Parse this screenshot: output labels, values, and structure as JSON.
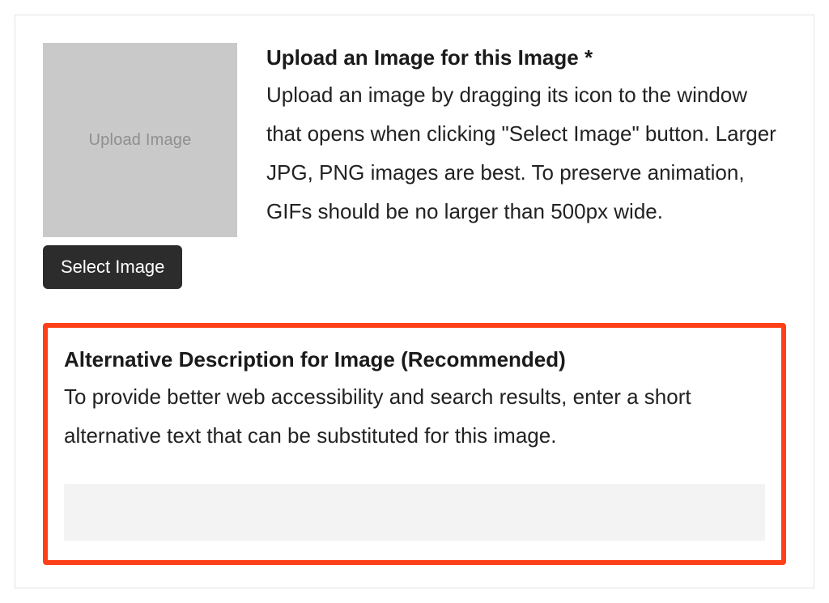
{
  "upload": {
    "placeholder_text": "Upload Image",
    "label": "Upload an Image for this Image *",
    "description": "Upload an image by dragging its icon to the window that opens when clicking \"Select Image\" button. Larger JPG, PNG images are best. To preserve animation, GIFs should be no larger than 500px wide.",
    "select_button": "Select Image"
  },
  "alt": {
    "label": "Alternative Description for Image (Recommended)",
    "description": "To provide better web accessibility and search results, enter a short alternative text that can be substituted for this image.",
    "value": "",
    "highlight_color": "#ff4019"
  }
}
